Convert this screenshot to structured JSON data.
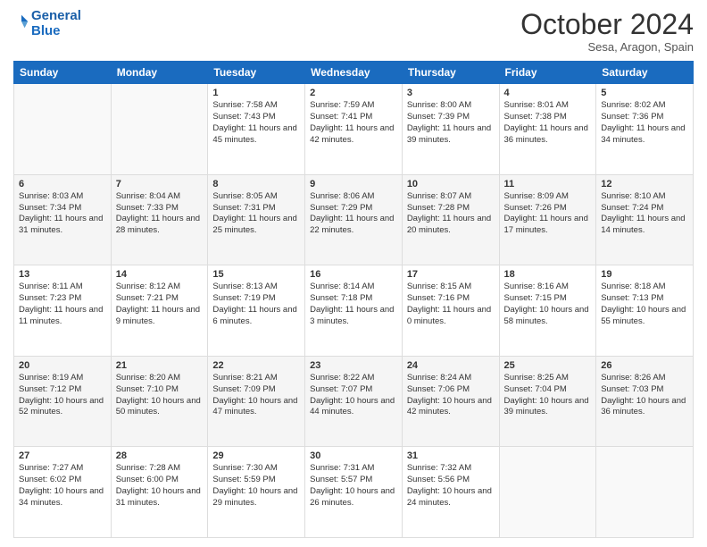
{
  "header": {
    "logo_line1": "General",
    "logo_line2": "Blue",
    "month": "October 2024",
    "location": "Sesa, Aragon, Spain"
  },
  "weekdays": [
    "Sunday",
    "Monday",
    "Tuesday",
    "Wednesday",
    "Thursday",
    "Friday",
    "Saturday"
  ],
  "weeks": [
    [
      {
        "num": "",
        "info": ""
      },
      {
        "num": "",
        "info": ""
      },
      {
        "num": "1",
        "info": "Sunrise: 7:58 AM\nSunset: 7:43 PM\nDaylight: 11 hours and 45 minutes."
      },
      {
        "num": "2",
        "info": "Sunrise: 7:59 AM\nSunset: 7:41 PM\nDaylight: 11 hours and 42 minutes."
      },
      {
        "num": "3",
        "info": "Sunrise: 8:00 AM\nSunset: 7:39 PM\nDaylight: 11 hours and 39 minutes."
      },
      {
        "num": "4",
        "info": "Sunrise: 8:01 AM\nSunset: 7:38 PM\nDaylight: 11 hours and 36 minutes."
      },
      {
        "num": "5",
        "info": "Sunrise: 8:02 AM\nSunset: 7:36 PM\nDaylight: 11 hours and 34 minutes."
      }
    ],
    [
      {
        "num": "6",
        "info": "Sunrise: 8:03 AM\nSunset: 7:34 PM\nDaylight: 11 hours and 31 minutes."
      },
      {
        "num": "7",
        "info": "Sunrise: 8:04 AM\nSunset: 7:33 PM\nDaylight: 11 hours and 28 minutes."
      },
      {
        "num": "8",
        "info": "Sunrise: 8:05 AM\nSunset: 7:31 PM\nDaylight: 11 hours and 25 minutes."
      },
      {
        "num": "9",
        "info": "Sunrise: 8:06 AM\nSunset: 7:29 PM\nDaylight: 11 hours and 22 minutes."
      },
      {
        "num": "10",
        "info": "Sunrise: 8:07 AM\nSunset: 7:28 PM\nDaylight: 11 hours and 20 minutes."
      },
      {
        "num": "11",
        "info": "Sunrise: 8:09 AM\nSunset: 7:26 PM\nDaylight: 11 hours and 17 minutes."
      },
      {
        "num": "12",
        "info": "Sunrise: 8:10 AM\nSunset: 7:24 PM\nDaylight: 11 hours and 14 minutes."
      }
    ],
    [
      {
        "num": "13",
        "info": "Sunrise: 8:11 AM\nSunset: 7:23 PM\nDaylight: 11 hours and 11 minutes."
      },
      {
        "num": "14",
        "info": "Sunrise: 8:12 AM\nSunset: 7:21 PM\nDaylight: 11 hours and 9 minutes."
      },
      {
        "num": "15",
        "info": "Sunrise: 8:13 AM\nSunset: 7:19 PM\nDaylight: 11 hours and 6 minutes."
      },
      {
        "num": "16",
        "info": "Sunrise: 8:14 AM\nSunset: 7:18 PM\nDaylight: 11 hours and 3 minutes."
      },
      {
        "num": "17",
        "info": "Sunrise: 8:15 AM\nSunset: 7:16 PM\nDaylight: 11 hours and 0 minutes."
      },
      {
        "num": "18",
        "info": "Sunrise: 8:16 AM\nSunset: 7:15 PM\nDaylight: 10 hours and 58 minutes."
      },
      {
        "num": "19",
        "info": "Sunrise: 8:18 AM\nSunset: 7:13 PM\nDaylight: 10 hours and 55 minutes."
      }
    ],
    [
      {
        "num": "20",
        "info": "Sunrise: 8:19 AM\nSunset: 7:12 PM\nDaylight: 10 hours and 52 minutes."
      },
      {
        "num": "21",
        "info": "Sunrise: 8:20 AM\nSunset: 7:10 PM\nDaylight: 10 hours and 50 minutes."
      },
      {
        "num": "22",
        "info": "Sunrise: 8:21 AM\nSunset: 7:09 PM\nDaylight: 10 hours and 47 minutes."
      },
      {
        "num": "23",
        "info": "Sunrise: 8:22 AM\nSunset: 7:07 PM\nDaylight: 10 hours and 44 minutes."
      },
      {
        "num": "24",
        "info": "Sunrise: 8:24 AM\nSunset: 7:06 PM\nDaylight: 10 hours and 42 minutes."
      },
      {
        "num": "25",
        "info": "Sunrise: 8:25 AM\nSunset: 7:04 PM\nDaylight: 10 hours and 39 minutes."
      },
      {
        "num": "26",
        "info": "Sunrise: 8:26 AM\nSunset: 7:03 PM\nDaylight: 10 hours and 36 minutes."
      }
    ],
    [
      {
        "num": "27",
        "info": "Sunrise: 7:27 AM\nSunset: 6:02 PM\nDaylight: 10 hours and 34 minutes."
      },
      {
        "num": "28",
        "info": "Sunrise: 7:28 AM\nSunset: 6:00 PM\nDaylight: 10 hours and 31 minutes."
      },
      {
        "num": "29",
        "info": "Sunrise: 7:30 AM\nSunset: 5:59 PM\nDaylight: 10 hours and 29 minutes."
      },
      {
        "num": "30",
        "info": "Sunrise: 7:31 AM\nSunset: 5:57 PM\nDaylight: 10 hours and 26 minutes."
      },
      {
        "num": "31",
        "info": "Sunrise: 7:32 AM\nSunset: 5:56 PM\nDaylight: 10 hours and 24 minutes."
      },
      {
        "num": "",
        "info": ""
      },
      {
        "num": "",
        "info": ""
      }
    ]
  ]
}
